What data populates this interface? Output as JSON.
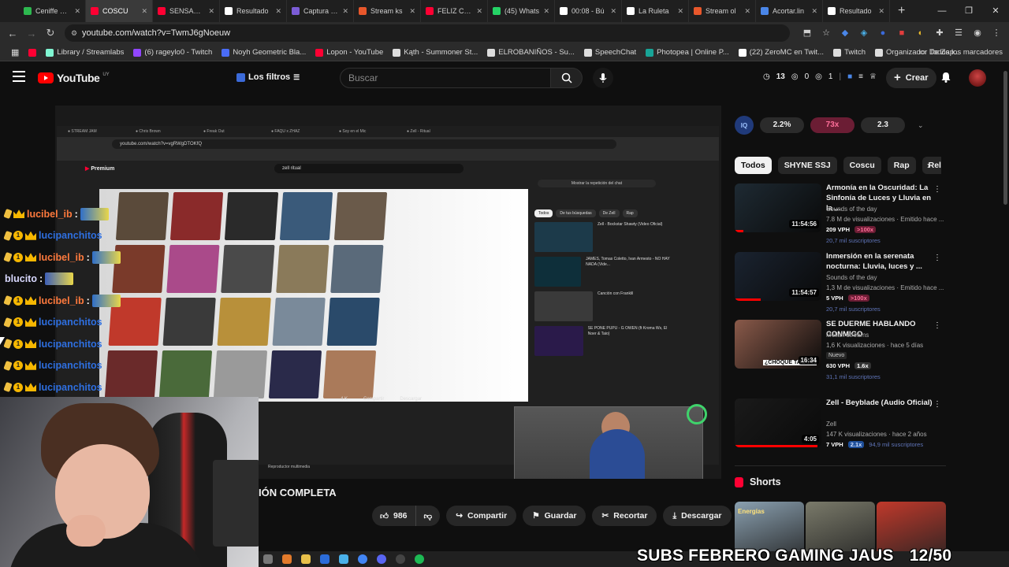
{
  "browser": {
    "tabs": [
      {
        "label": "Ceniffe Stre",
        "fav": "#2db84f",
        "active": false
      },
      {
        "label": "COSCU",
        "fav": "#ff0033",
        "active": true
      },
      {
        "label": "SENSACIÓ",
        "fav": "#ff0033",
        "active": false
      },
      {
        "label": "Resultado",
        "fav": "#ffffff",
        "active": false
      },
      {
        "label": "Captura de",
        "fav": "#7b5cd6",
        "active": false
      },
      {
        "label": "Stream ks",
        "fav": "#e8572b",
        "active": false
      },
      {
        "label": "FELIZ CUM",
        "fav": "#ff0033",
        "active": false
      },
      {
        "label": "(45) Whats",
        "fav": "#25d366",
        "active": false
      },
      {
        "label": "00:08 - Bú",
        "fav": "#ffffff",
        "active": false
      },
      {
        "label": "La Ruleta",
        "fav": "#ffffff",
        "active": false
      },
      {
        "label": "Stream ol",
        "fav": "#e8572b",
        "active": false
      },
      {
        "label": "Acortar.lin",
        "fav": "#4a86e8",
        "active": false
      },
      {
        "label": "Resultado",
        "fav": "#ffffff",
        "active": false
      }
    ],
    "url": "youtube.com/watch?v=TwmJ6gNoeuw",
    "bookmarks": [
      {
        "label": "Library / Streamlabs",
        "color": "#80f5d2"
      },
      {
        "label": "(6) rageylo0 - Twitch",
        "color": "#9146ff"
      },
      {
        "label": "Noyh Geometric Bla...",
        "color": "#4a6cf7"
      },
      {
        "label": "Lopon - YouTube",
        "color": "#ff0033"
      },
      {
        "label": "Kąth - Summoner St...",
        "color": "#dddddd"
      },
      {
        "label": "ELROBANIÑOS - Su...",
        "color": "#dddddd"
      },
      {
        "label": "SpeechChat",
        "color": "#dddddd"
      },
      {
        "label": "Photopea | Online P...",
        "color": "#18a497"
      },
      {
        "label": "(22) ZeroMC en Twit...",
        "color": "#ffffff"
      },
      {
        "label": "Twitch",
        "color": "#dddddd"
      },
      {
        "label": "Organizador De Zap...",
        "color": "#dddddd"
      }
    ],
    "bookmarks_all": "Todos los marcadores"
  },
  "yt": {
    "logo": "YouTube",
    "country": "UY",
    "filters_label": "Los filtros",
    "search_placeholder": "Buscar",
    "stats": {
      "a": "13",
      "b": "0",
      "c": "1"
    },
    "create_label": "Crear"
  },
  "player": {
    "inner_url": "youtube.com/watch?v=vgRWgDTOKfQ",
    "inner_search": "zell ritual",
    "inner_logo": "Premium",
    "inner_chat_btn": "Mostrar la repetición del chat",
    "inner_chips": [
      "Todos",
      "De tus búsquedas",
      "De Zell",
      "Rap"
    ],
    "inner_side": [
      {
        "t": "Zell - Bockstar Shawty (Video Oficial)",
        "c": "#1c3a4a"
      },
      {
        "t": "JAMES, Tomas Coletto, Ivan Armesto - NO HAY NADA (Vide...",
        "c": "#0e2f3a"
      },
      {
        "t": "Canción con Franklil",
        "c": "#3a3a3a"
      },
      {
        "t": "SE PONE PUPU - G OWEN (ft Kroma Ws, El Noer & Taio)",
        "c": "#2a1a4a"
      }
    ],
    "inner_controls": [
      "4 K",
      "Compartir",
      "Descargar"
    ],
    "inner_footer": "Reproductor multimedia"
  },
  "chat": [
    {
      "user": "lucibel_ib",
      "color": "#ff7a3d",
      "badges": "sub-king",
      "emote": "#2f6fc9"
    },
    {
      "user": "lucipanchitos",
      "color": "#2e6fe0",
      "badges": "sub-coin-king",
      "emote": ""
    },
    {
      "user": "lucibel_ib",
      "color": "#ff7a3d",
      "badges": "sub-coin-king",
      "emote": "#2f6fc9"
    },
    {
      "user": "blucito",
      "color": "#d9d9ff",
      "badges": "",
      "emote": "#3d5fb8"
    },
    {
      "user": "lucibel_ib",
      "color": "#ff7a3d",
      "badges": "sub-coin-king",
      "emote": "#2f6fc9"
    },
    {
      "user": "lucipanchitos",
      "color": "#2e6fe0",
      "badges": "sub-coin-king",
      "emote": ""
    },
    {
      "user": "lucipanchitos",
      "color": "#2e6fe0",
      "badges": "sub-coin-king",
      "emote": ""
    },
    {
      "user": "lucipanchitos",
      "color": "#2e6fe0",
      "badges": "sub-coin-king",
      "emote": ""
    },
    {
      "user": "lucipanchitos",
      "color": "#2e6fe0",
      "badges": "sub-coin-king",
      "emote": ""
    }
  ],
  "video": {
    "title_fragment": "IÓN COMPLETA",
    "likes": "986",
    "share": "Compartir",
    "save": "Guardar",
    "clip": "Recortar",
    "download": "Descargar"
  },
  "sidebar": {
    "ext": {
      "a": "2.2%",
      "b": "73x",
      "c": "2.3"
    },
    "chips": [
      "Todos",
      "SHYNE SSJ",
      "Coscu",
      "Rap",
      "Relac"
    ],
    "recs": [
      {
        "title": "Armonía en la Oscuridad: La Sinfonía de Luces y Lluvia en la ...",
        "channel": "Sounds of the day",
        "meta": "7.8 M de visualizaciones · Emitido hace ...",
        "vph": "209 VPH",
        "pct": ">100x",
        "pct_style": "red",
        "subs": "20,7 mil suscriptores",
        "duration": "11:54:56",
        "progress": 0.1,
        "thumb": "#1e2a33"
      },
      {
        "title": "Inmersión en la serenata nocturna: Lluvia, luces y ...",
        "channel": "Sounds of the day",
        "meta": "1,3 M de visualizaciones · Emitido hace ...",
        "vph": "5 VPH",
        "pct": ">100x",
        "pct_style": "red",
        "subs": "20,7 mil suscriptores",
        "duration": "11:54:57",
        "progress": 0.3,
        "thumb": "#1a2330"
      },
      {
        "title": "SE DUERME HABLANDO CONMIGO",
        "channel": "Melian streams",
        "meta": "1,6 K visualizaciones · hace 5 días",
        "badge": "Nuevo",
        "vph": "630 VPH",
        "pct": "1.6x",
        "pct_style": "plain",
        "subs": "31,1 mil suscriptores",
        "duration": "16:34",
        "progress": 0,
        "thumb": "#8a5a4a",
        "overlay_text": "¿CHOQUE TAPUL?"
      },
      {
        "title": "Zell - Beyblade (Audio Oficial)",
        "channel": "Zell",
        "meta": "147 K visualizaciones · hace 2 años",
        "vph": "7 VPH",
        "pct": "2.1x",
        "pct_style": "blue",
        "subs": "94,9 mil suscriptores",
        "duration": "4:05",
        "progress": 0.95,
        "thumb": "#1a1a1a"
      }
    ],
    "shorts_label": "Shorts",
    "shorts": [
      {
        "color": "#8aa0b0",
        "caption": "Energías"
      },
      {
        "color": "#7a7a6a",
        "caption": ""
      },
      {
        "color": "#c0392b",
        "caption": ""
      }
    ]
  },
  "overlay": {
    "subs_text": "SUBS FEBRERO GAMING JAUS",
    "subs_count": "12/50"
  }
}
